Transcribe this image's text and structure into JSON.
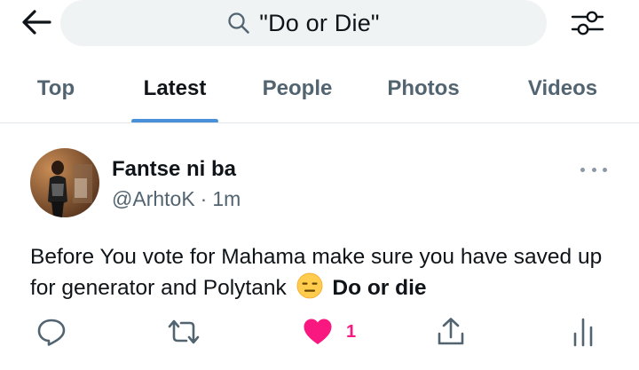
{
  "search": {
    "query": "\"Do or Die\"",
    "icon": "search-icon"
  },
  "header": {
    "back_icon": "arrow-left-icon",
    "filter_icon": "sliders-icon"
  },
  "tabs": [
    {
      "label": "Top",
      "active": false
    },
    {
      "label": "Latest",
      "active": true
    },
    {
      "label": "People",
      "active": false
    },
    {
      "label": "Photos",
      "active": false
    },
    {
      "label": "Videos",
      "active": false
    }
  ],
  "colors": {
    "accent": "#4a90d9",
    "like": "#f91880",
    "secondary_text": "#536471",
    "search_bg": "#eff3f4"
  },
  "tweet": {
    "display_name": "Fantse ni ba",
    "handle": "@ArhtoK",
    "separator": "·",
    "time": "1m",
    "text_part1": "Before You vote for Mahama make sure you have saved up for generator and Polytank",
    "emoji": "expressionless-face-emoji",
    "text_bold": "Do or die",
    "actions": {
      "reply_icon": "reply-icon",
      "retweet_icon": "retweet-icon",
      "like_icon": "heart-filled-icon",
      "like_count": "1",
      "share_icon": "share-icon",
      "analytics_icon": "analytics-icon"
    }
  }
}
